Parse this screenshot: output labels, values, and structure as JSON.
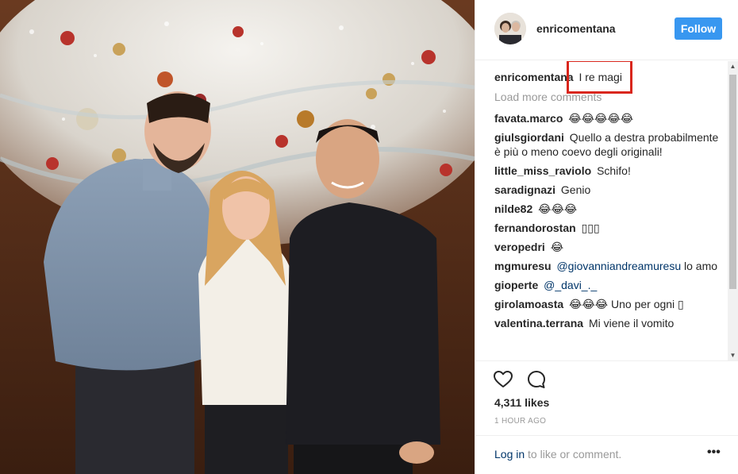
{
  "post": {
    "username": "enricomentana",
    "follow_label": "Follow",
    "caption_user": "enricomentana",
    "caption_text": "I re magi",
    "load_more": "Load more comments",
    "likes": "4,311 likes",
    "time": "1 HOUR AGO",
    "login_link": "Log in",
    "login_rest": "to like or comment.",
    "more_icon": "•••"
  },
  "comments": [
    {
      "user": "favata.marco",
      "text": "😂😂😂😂😂"
    },
    {
      "user": "giulsgiordani",
      "text": "Quello a destra probabilmente è più o meno coevo degli originali!"
    },
    {
      "user": "little_miss_raviolo",
      "text": "Schifo!"
    },
    {
      "user": "saradignazi",
      "text": "Genio"
    },
    {
      "user": "nilde82",
      "text": "😂😂😂"
    },
    {
      "user": "fernandorostan",
      "text": "▯▯▯"
    },
    {
      "user": "veropedri",
      "text": "😂"
    },
    {
      "user": "mgmuresu",
      "mention": "@giovanniandreamuresu",
      "text": "lo amo"
    },
    {
      "user": "gioperte",
      "mention": "@_davi_._",
      "text": ""
    },
    {
      "user": "girolamoasta",
      "text": "😂😂😂 Uno per ogni ▯"
    },
    {
      "user": "valentina.terrana",
      "text": "Mi viene il vomito"
    }
  ],
  "icons": {
    "heart": "heart-icon",
    "comment": "comment-icon",
    "more": "more-options-icon"
  },
  "colors": {
    "follow_bg": "#3897f0",
    "highlight": "#d9261c",
    "mention": "#003569",
    "muted": "#999999"
  }
}
